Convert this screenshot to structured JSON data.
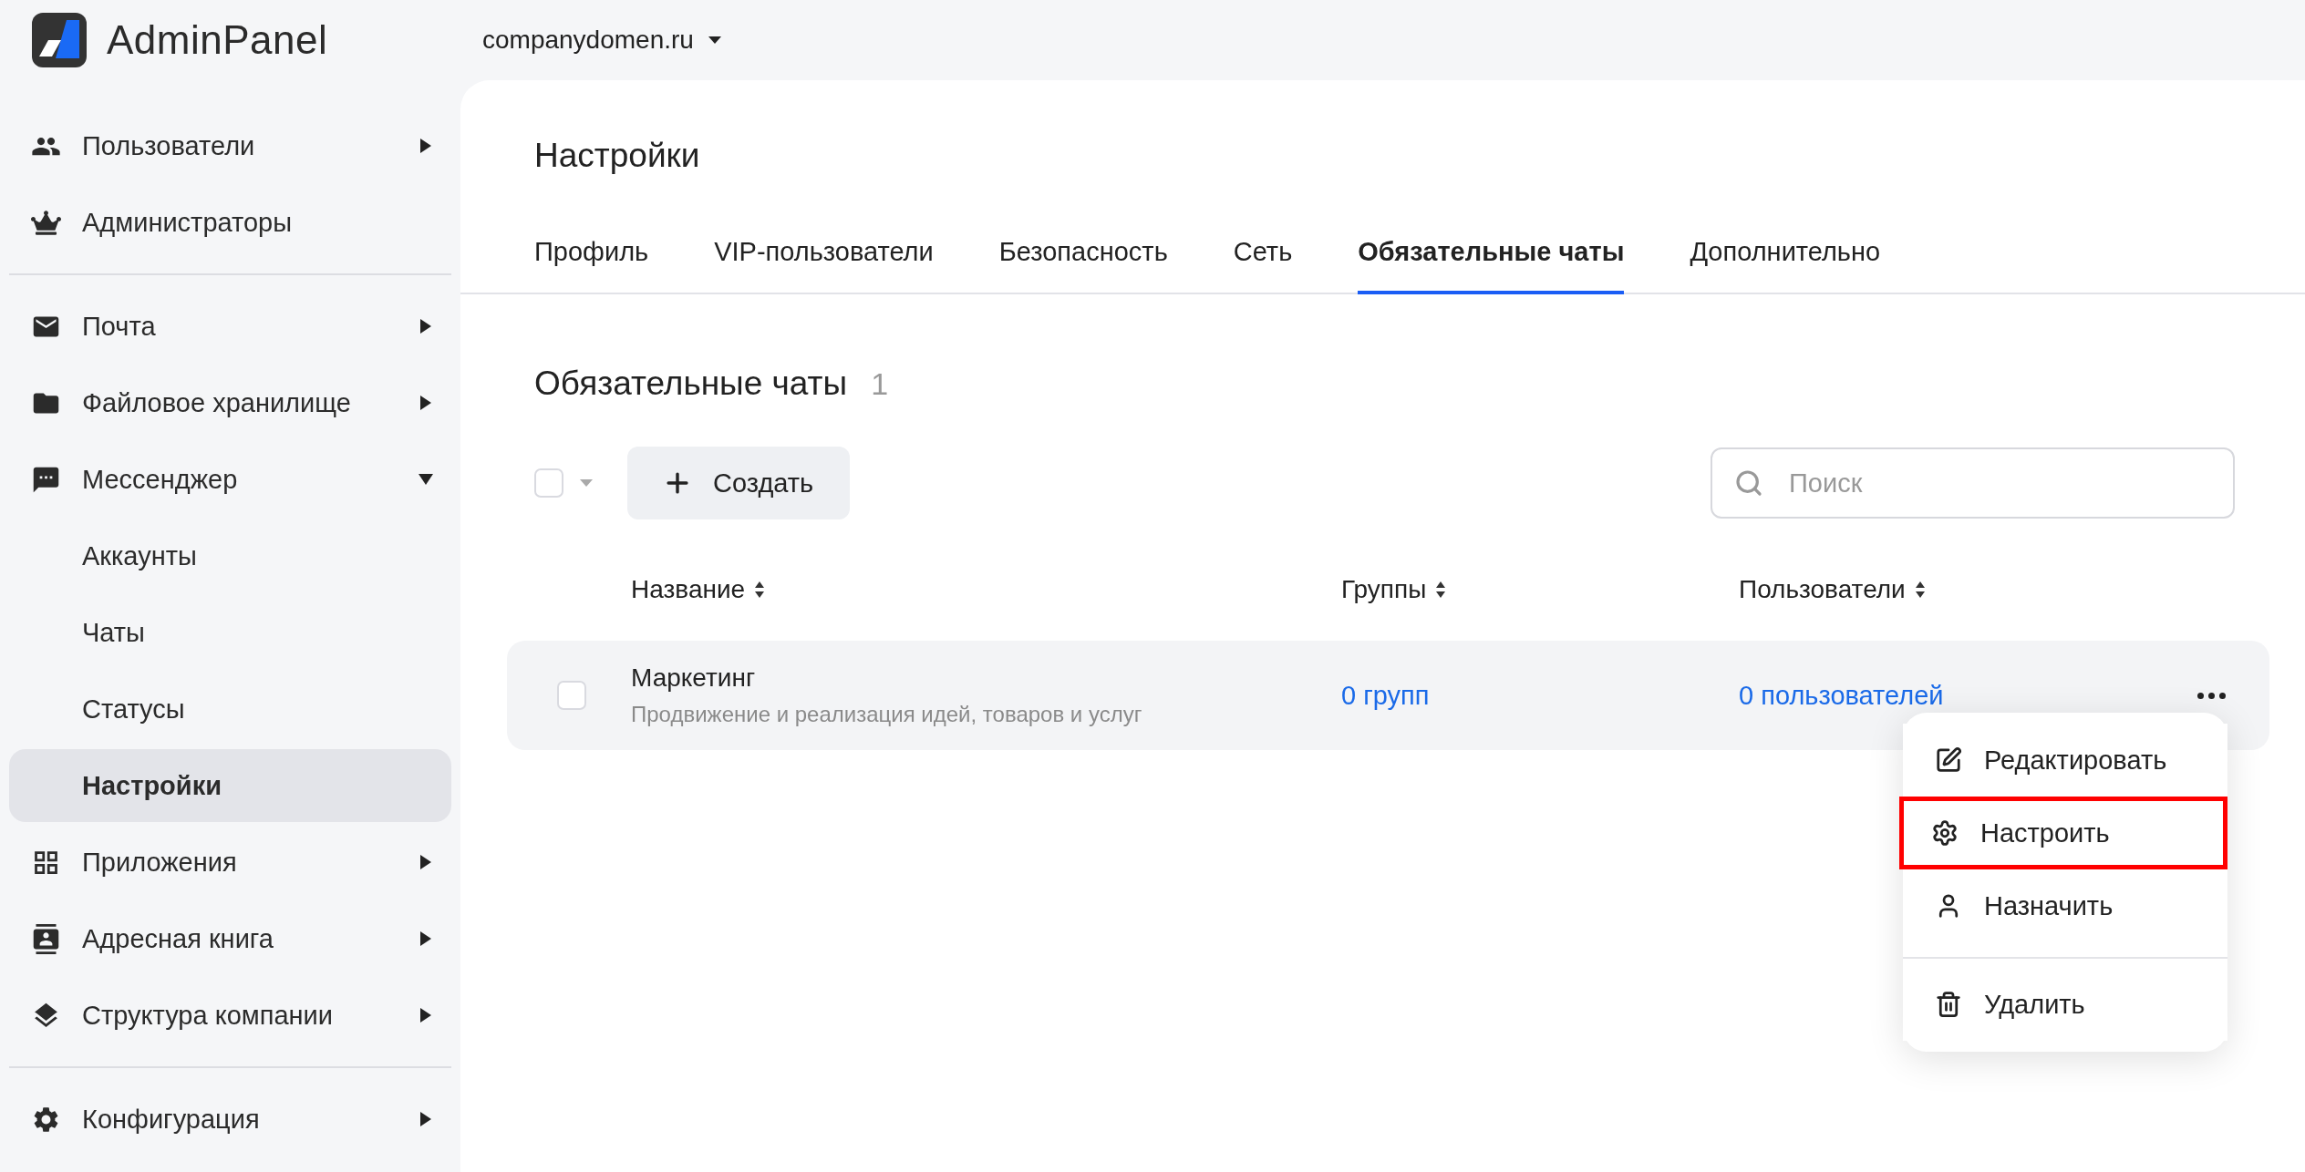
{
  "app": {
    "name": "AdminPanel",
    "domain": "companydomen.ru"
  },
  "sidebar": {
    "groups": [
      {
        "items": [
          {
            "label": "Пользователи",
            "kind": "group",
            "expanded": false,
            "selected": false
          },
          {
            "label": "Администраторы",
            "kind": "link",
            "selected": false
          }
        ]
      },
      {
        "items": [
          {
            "label": "Почта",
            "kind": "group",
            "expanded": false,
            "selected": false
          },
          {
            "label": "Файловое хранилище",
            "kind": "group",
            "expanded": false,
            "selected": false
          },
          {
            "label": "Мессенджер",
            "kind": "group",
            "expanded": true,
            "selected": false
          },
          {
            "label": "Аккаунты",
            "kind": "subitem",
            "selected": false
          },
          {
            "label": "Чаты",
            "kind": "subitem",
            "selected": false
          },
          {
            "label": "Статусы",
            "kind": "subitem",
            "selected": false
          },
          {
            "label": "Настройки",
            "kind": "subitem",
            "selected": true
          },
          {
            "label": "Приложения",
            "kind": "group",
            "expanded": false,
            "selected": false
          },
          {
            "label": "Адресная книга",
            "kind": "group",
            "expanded": false,
            "selected": false
          },
          {
            "label": "Структура компании",
            "kind": "group",
            "expanded": false,
            "selected": false
          }
        ]
      },
      {
        "items": [
          {
            "label": "Конфигурация",
            "kind": "group",
            "expanded": false,
            "selected": false
          }
        ]
      }
    ]
  },
  "page": {
    "title": "Настройки",
    "tabs": [
      {
        "label": "Профиль",
        "selected": false
      },
      {
        "label": "VIP-пользователи",
        "selected": false
      },
      {
        "label": "Безопасность",
        "selected": false
      },
      {
        "label": "Сеть",
        "selected": false
      },
      {
        "label": "Обязательные чаты",
        "selected": true
      },
      {
        "label": "Дополнительно",
        "selected": false
      }
    ],
    "section": {
      "title": "Обязательные чаты",
      "count": "1"
    },
    "toolbar": {
      "select_all": {
        "checked": false
      },
      "create_button": "Создать",
      "search": {
        "placeholder": "Поиск"
      }
    },
    "table": {
      "columns": [
        "Название",
        "Группы",
        "Пользователи"
      ],
      "rows": [
        {
          "checked": false,
          "name": "Маркетинг",
          "description": "Продвижение и реализация идей, товаров и услуг",
          "groups": "0 групп",
          "users": "0 пользователей"
        }
      ]
    },
    "context_menu": {
      "groups": [
        [
          {
            "label": "Редактировать",
            "highlighted": false
          },
          {
            "label": "Настроить",
            "highlighted": true
          },
          {
            "label": "Назначить",
            "highlighted": false
          }
        ],
        [
          {
            "label": "Удалить",
            "highlighted": false
          }
        ]
      ]
    }
  }
}
